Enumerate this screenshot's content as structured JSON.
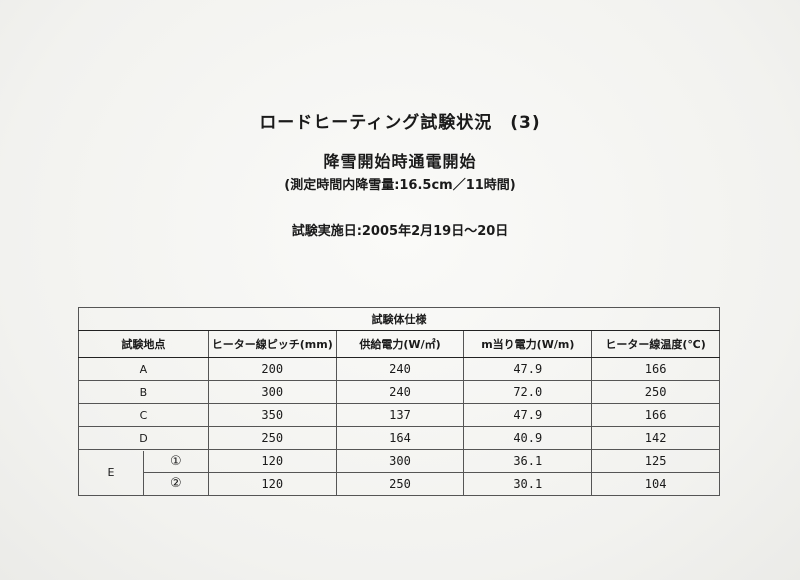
{
  "document": {
    "title": "ロードヒーティング試験状況　(3)",
    "subtitle": "降雪開始時通電開始",
    "conditions": "(測定時間内降雪量:16.5cm／11時間)",
    "test_date": "試験実施日:2005年2月19日～20日"
  },
  "table": {
    "caption": "試験体仕様",
    "headers": [
      "試験地点",
      "ヒーター線ピッチ(mm)",
      "供給電力(W/㎡)",
      "m当り電力(W/m)",
      "ヒーター線温度(℃)"
    ],
    "rows": [
      {
        "point": "A",
        "pitch": "200",
        "power": "240",
        "per_m": "47.9",
        "temp": "166"
      },
      {
        "point": "B",
        "pitch": "300",
        "power": "240",
        "per_m": "72.0",
        "temp": "250"
      },
      {
        "point": "C",
        "pitch": "350",
        "power": "137",
        "per_m": "47.9",
        "temp": "166"
      },
      {
        "point": "D",
        "pitch": "250",
        "power": "164",
        "per_m": "40.9",
        "temp": "142"
      }
    ],
    "group_e": {
      "point": "E",
      "rows": [
        {
          "sub": "①",
          "pitch": "120",
          "power": "300",
          "per_m": "36.1",
          "temp": "125"
        },
        {
          "sub": "②",
          "pitch": "120",
          "power": "250",
          "per_m": "30.1",
          "temp": "104"
        }
      ]
    }
  }
}
